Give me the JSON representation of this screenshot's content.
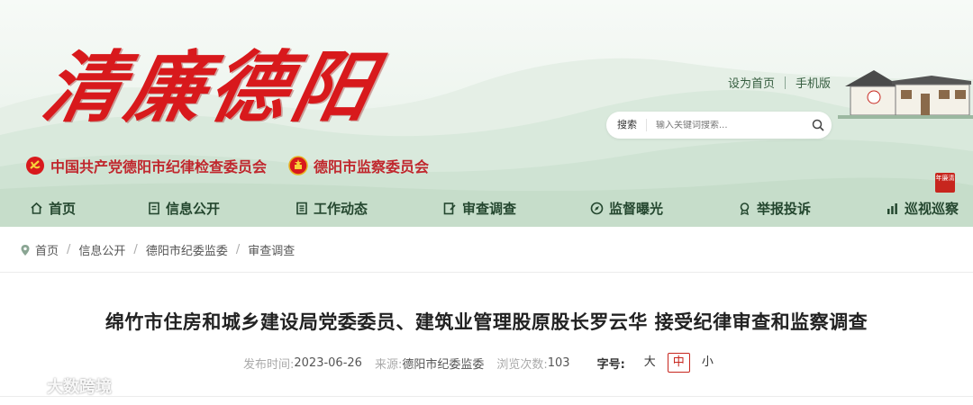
{
  "site": {
    "logo_text": "清廉德阳",
    "top_links": [
      "设为首页",
      "手机版"
    ],
    "search": {
      "label": "搜索",
      "placeholder": "输入关键词搜索..."
    },
    "orgs": [
      "中国共产党德阳市纪律检查委员会",
      "德阳市监察委员会"
    ],
    "seal_text": "年廉清"
  },
  "nav": {
    "items": [
      {
        "label": "首页",
        "icon": "home-icon"
      },
      {
        "label": "信息公开",
        "icon": "document-icon"
      },
      {
        "label": "工作动态",
        "icon": "list-icon"
      },
      {
        "label": "审查调查",
        "icon": "edit-doc-icon"
      },
      {
        "label": "监督曝光",
        "icon": "compass-icon"
      },
      {
        "label": "举报投诉",
        "icon": "award-icon"
      },
      {
        "label": "巡视巡察",
        "icon": "bar-chart-icon"
      }
    ]
  },
  "breadcrumb": [
    "首页",
    "信息公开",
    "德阳市纪委监委",
    "审查调查"
  ],
  "article": {
    "title": "绵竹市住房和城乡建设局党委委员、建筑业管理股原股长罗云华 接受纪律审查和监察调查",
    "publish_label": "发布时间:",
    "publish_date": "2023-06-26",
    "source_label": "来源:",
    "source": "德阳市纪委监委",
    "views_label": "浏览次数:",
    "views": "103",
    "font_size_label": "字号:",
    "font_sizes": [
      "大",
      "中",
      "小"
    ],
    "font_size_selected": "中"
  },
  "watermark": "大数跨境",
  "colors": {
    "brand_red": "#d8191c",
    "nav_green": "#24472f",
    "active_border": "#c7261e"
  }
}
